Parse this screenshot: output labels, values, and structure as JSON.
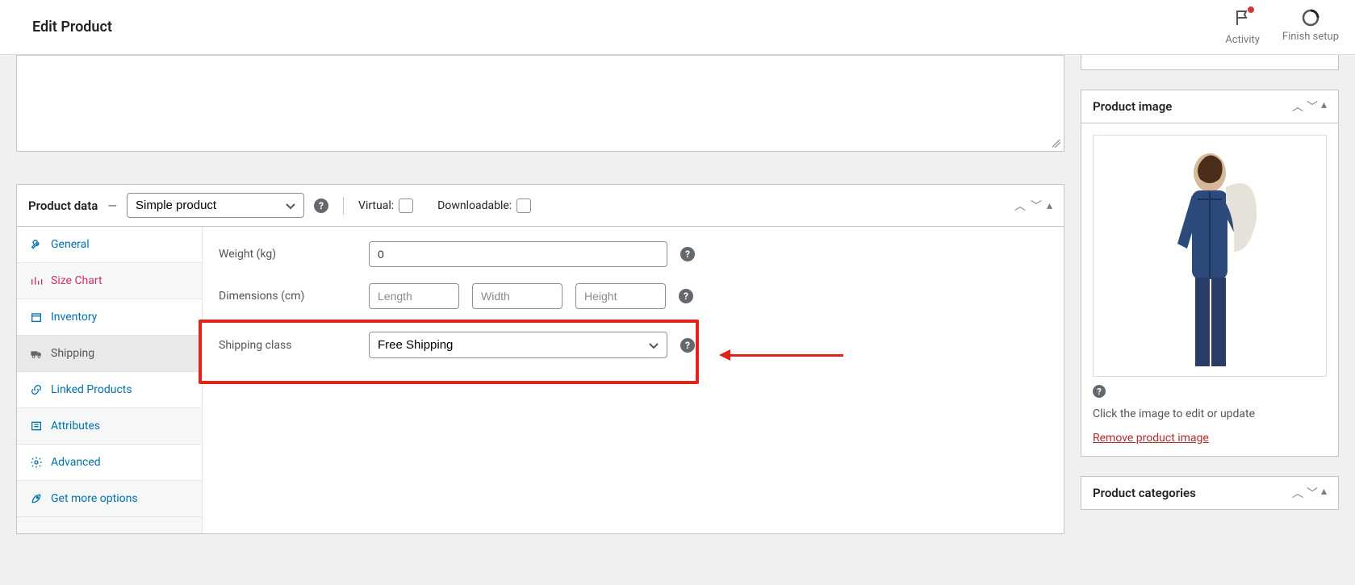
{
  "topbar": {
    "title": "Edit Product",
    "activity_label": "Activity",
    "finish_label": "Finish setup"
  },
  "product_data": {
    "title": "Product data",
    "dash": "—",
    "type_options": [
      "Simple product"
    ],
    "type_selected": "Simple product",
    "virtual_label": "Virtual:",
    "downloadable_label": "Downloadable:"
  },
  "tabs": {
    "general": "General",
    "size_chart": "Size Chart",
    "inventory": "Inventory",
    "shipping": "Shipping",
    "linked": "Linked Products",
    "attributes": "Attributes",
    "advanced": "Advanced",
    "more": "Get more options"
  },
  "shipping_form": {
    "weight_label": "Weight (kg)",
    "weight_value": "0",
    "dimensions_label": "Dimensions (cm)",
    "length_ph": "Length",
    "width_ph": "Width",
    "height_ph": "Height",
    "class_label": "Shipping class",
    "class_selected": "Free Shipping",
    "class_options": [
      "Free Shipping"
    ]
  },
  "side": {
    "product_image_title": "Product image",
    "image_hint": "Click the image to edit or update",
    "remove_link": "Remove product image",
    "categories_title": "Product categories"
  }
}
